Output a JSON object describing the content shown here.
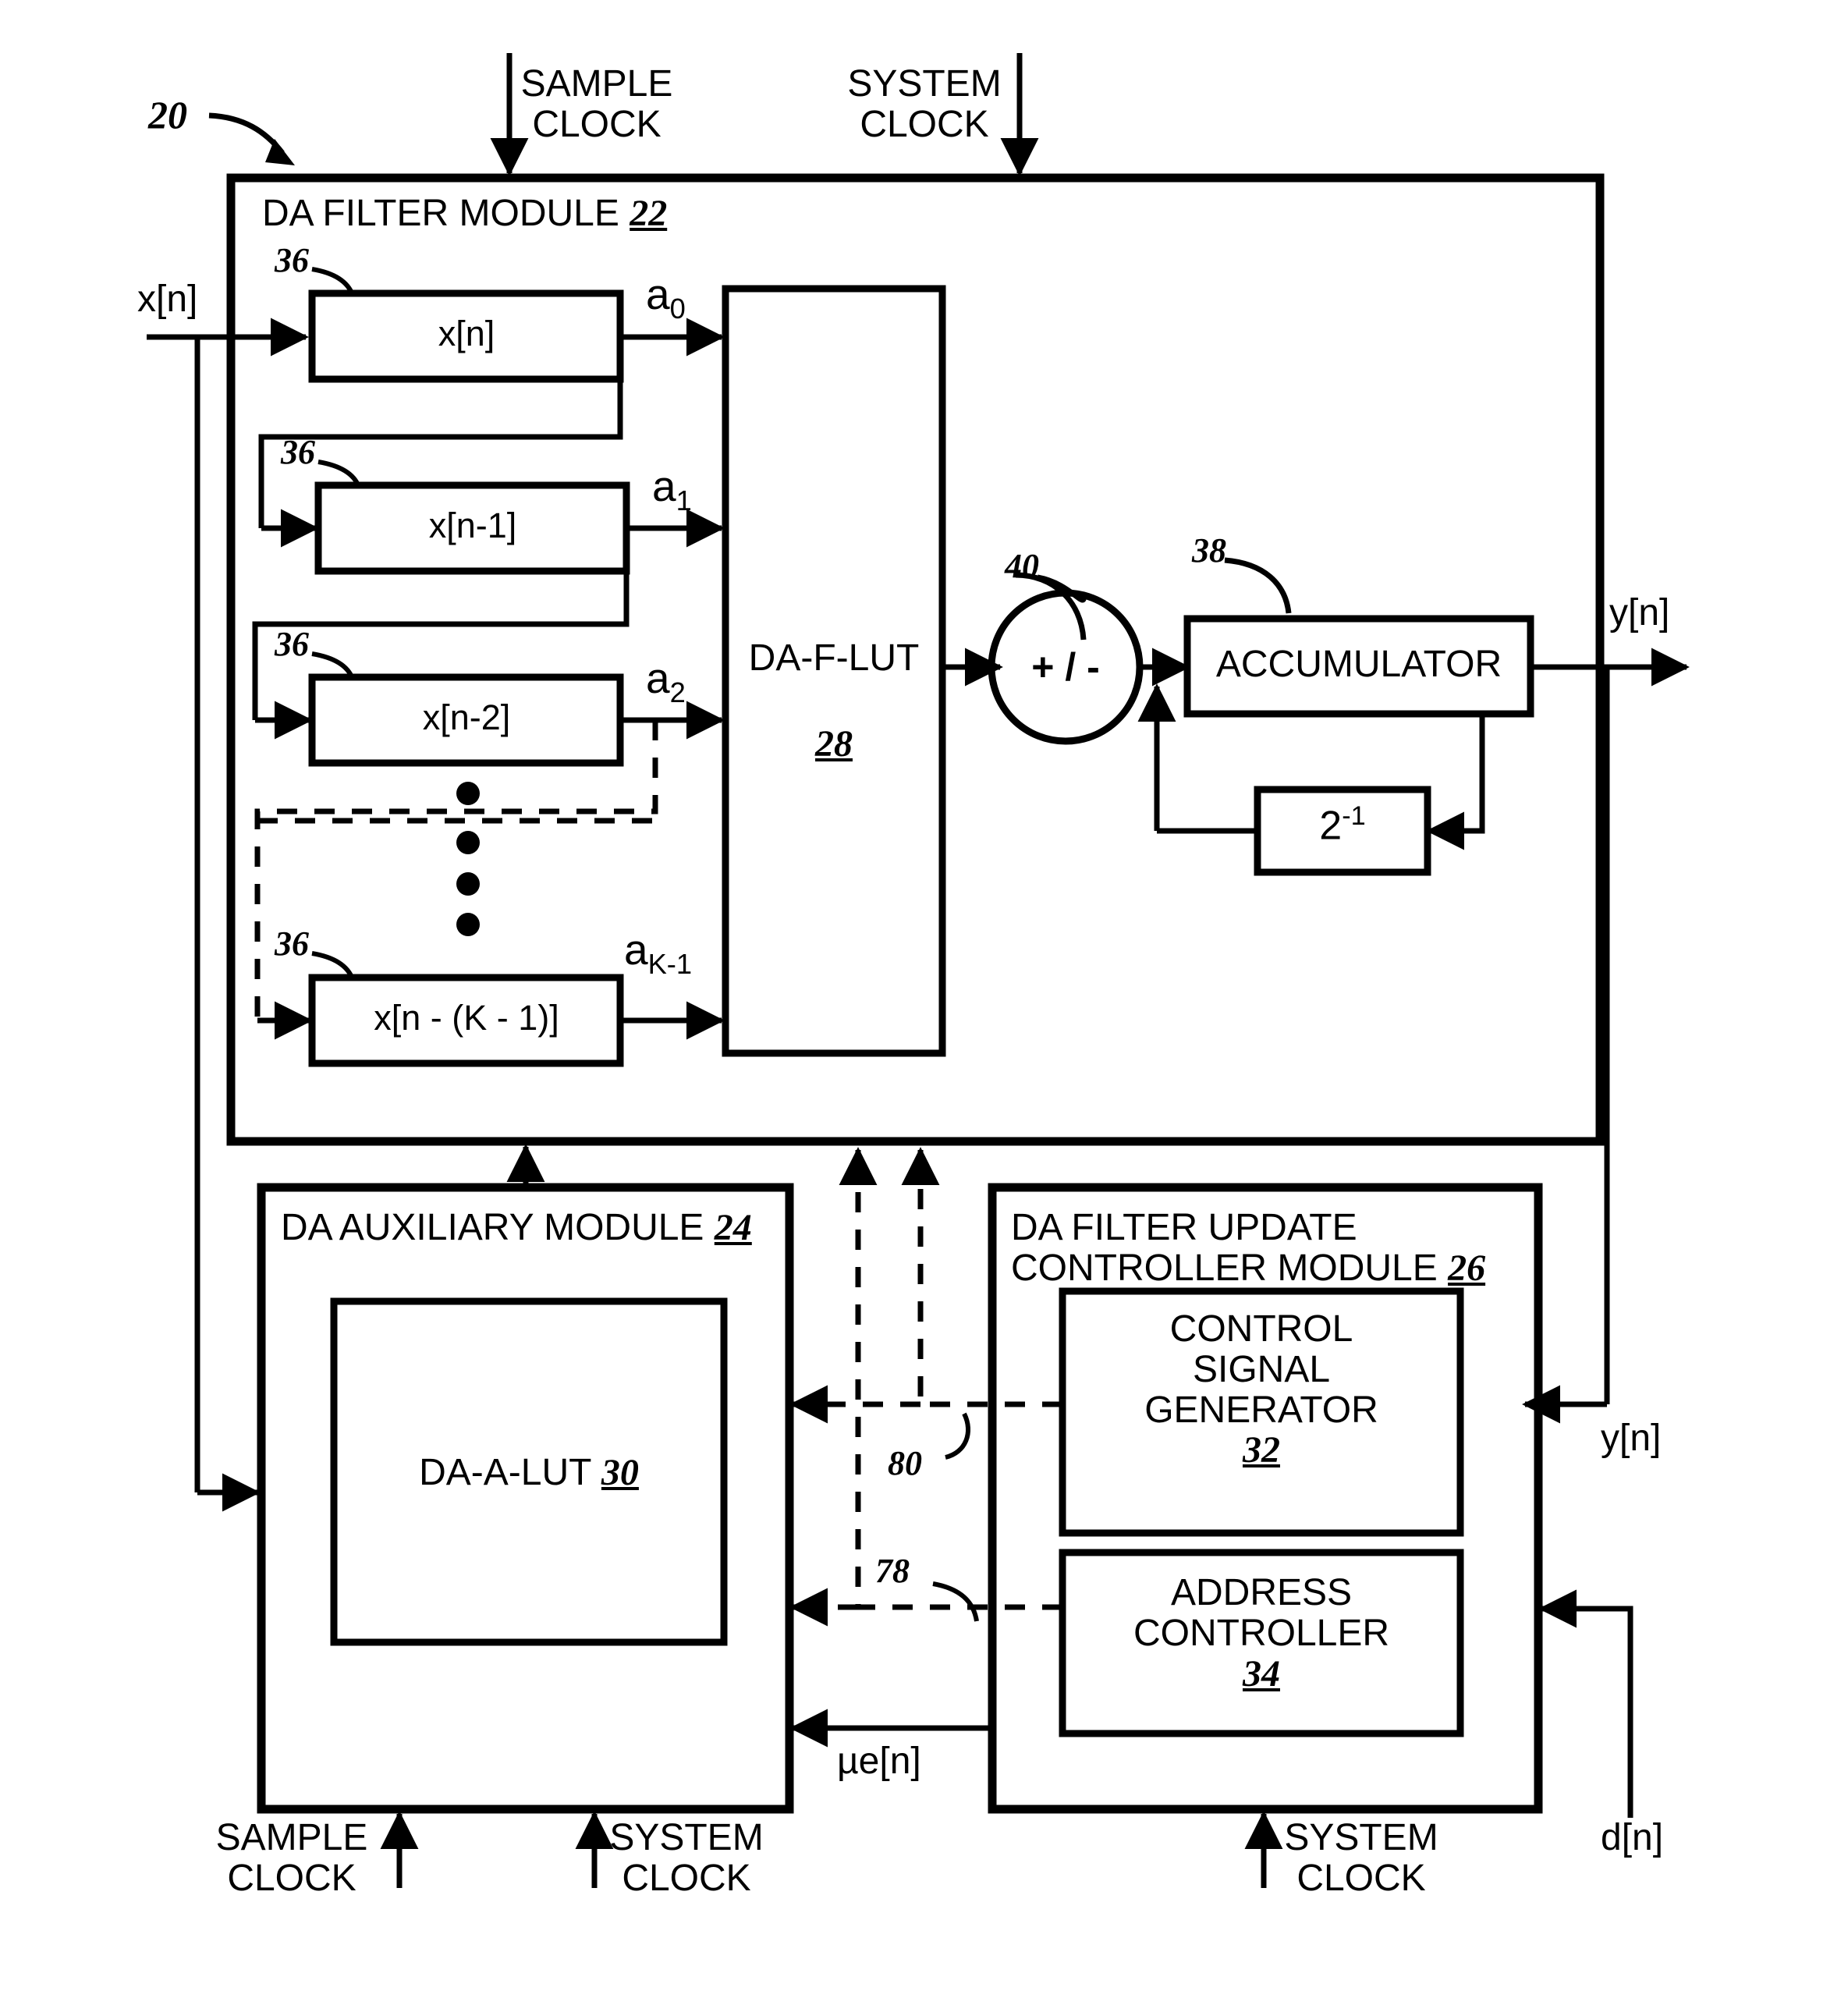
{
  "figure": {
    "ref_number": "20"
  },
  "top_clocks": [
    {
      "name": "sample-clock",
      "line1": "SAMPLE",
      "line2": "CLOCK"
    },
    {
      "name": "system-clock",
      "line1": "SYSTEM",
      "line2": "CLOCK"
    }
  ],
  "filter_module": {
    "title": "DA FILTER MODULE",
    "ref": "22",
    "input_signal": "x[n]",
    "output_signal": "y[n]",
    "delay_ref": "36",
    "taps": [
      {
        "label": "x[n]",
        "coef_base": "a",
        "coef_sub": "0",
        "ref": "36"
      },
      {
        "label": "x[n-1]",
        "coef_base": "a",
        "coef_sub": "1",
        "ref": "36"
      },
      {
        "label": "x[n-2]",
        "coef_base": "a",
        "coef_sub": "2",
        "ref": "36"
      },
      {
        "label": "x[n - (K - 1)]",
        "coef_base": "a",
        "coef_sub": "K-1",
        "ref": "36"
      }
    ],
    "lut": {
      "label": "DA-F-LUT",
      "ref": "28"
    },
    "adder": {
      "label": "+ / -",
      "ref": "40"
    },
    "accumulator": {
      "label": "ACCUMULATOR",
      "ref": "38"
    },
    "delay_feedback": {
      "base": "2",
      "exp": "-1"
    }
  },
  "auxiliary_module": {
    "title": "DA AUXILIARY MODULE",
    "ref": "24",
    "lut": {
      "label": "DA-A-LUT",
      "ref": "30"
    },
    "clocks": [
      {
        "name": "sample-clock",
        "line1": "SAMPLE",
        "line2": "CLOCK"
      },
      {
        "name": "system-clock",
        "line1": "SYSTEM",
        "line2": "CLOCK"
      }
    ]
  },
  "update_controller_module": {
    "title_line1": "DA FILTER UPDATE",
    "title_line2": "CONTROLLER MODULE",
    "ref": "26",
    "blocks": [
      {
        "lines": [
          "CONTROL",
          "SIGNAL",
          "GENERATOR"
        ],
        "ref": "32"
      },
      {
        "lines": [
          "ADDRESS",
          "CONTROLLER"
        ],
        "ref": "34"
      }
    ],
    "clock": {
      "line1": "SYSTEM",
      "line2": "CLOCK"
    },
    "input_y": "y[n]",
    "input_d": "d[n]",
    "output_mue": "µe[n]"
  },
  "bus_refs": {
    "control_signal_bus": "80",
    "address_bus": "78"
  }
}
